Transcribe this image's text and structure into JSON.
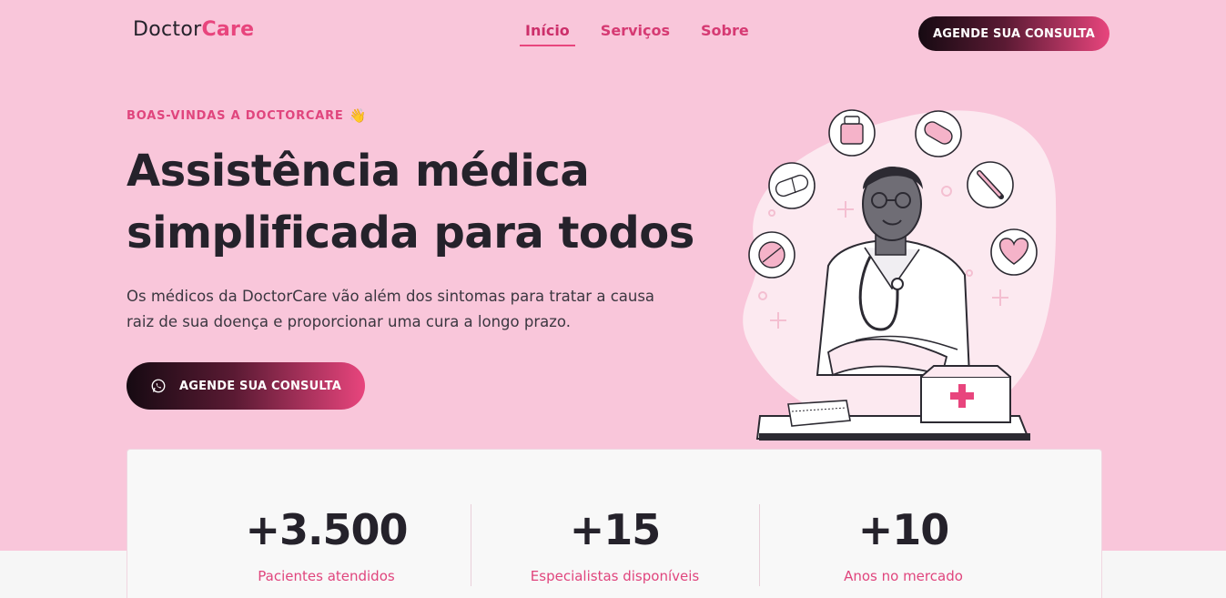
{
  "header": {
    "logo_prefix": "Doctor",
    "logo_suffix": "Care",
    "nav": [
      "Início",
      "Serviços",
      "Sobre"
    ],
    "active_nav": "Início",
    "cta_label": "AGENDE SUA CONSULTA"
  },
  "hero": {
    "eyebrow": "BOAS-VINDAS A DOCTORCARE",
    "eyebrow_emoji": "👋",
    "headline_line1": "Assistência médica",
    "headline_line2": "simplificada para todos",
    "description": "Os médicos da DoctorCare vão além dos sintomas para tratar a causa raiz de sua doença e proporcionar uma cura a longo prazo.",
    "cta_label": "AGENDE SUA CONSULTA",
    "cta_icon": "whatsapp-icon"
  },
  "stats": [
    {
      "value": "+3.500",
      "label": "Pacientes atendidos"
    },
    {
      "value": "+15",
      "label": "Especialistas disponíveis"
    },
    {
      "value": "+10",
      "label": "Anos no mercado"
    }
  ],
  "colors": {
    "hero_bg": "#f9c6da",
    "accent": "#e8457d",
    "text_dark": "#25222b",
    "stats_bg": "#f8f8f8"
  }
}
